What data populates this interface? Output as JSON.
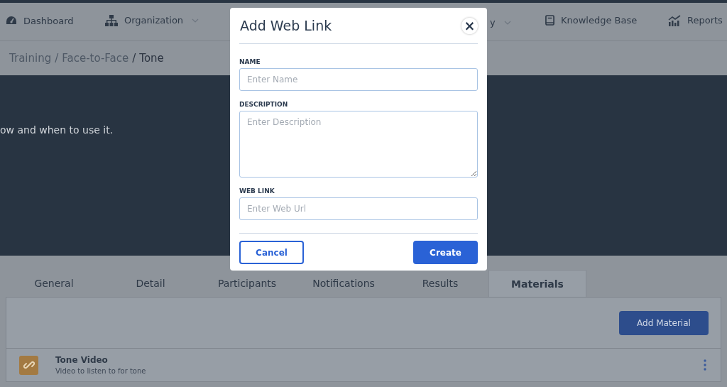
{
  "nav": [
    {
      "label": "Dashboard",
      "dropdown": false
    },
    {
      "label": "Organization",
      "dropdown": true
    },
    {
      "label": "y",
      "dropdown": true
    },
    {
      "label": "Knowledge Base",
      "dropdown": false
    },
    {
      "label": "Reports",
      "dropdown": false
    }
  ],
  "breadcrumb": [
    {
      "label": "Training",
      "current": false
    },
    {
      "separator": "/",
      "label": "Face-to-Face",
      "current": false
    },
    {
      "separator": "/",
      "label": "Tone",
      "current": true
    }
  ],
  "banner": {
    "text": "ow and when to use it."
  },
  "tabs": [
    {
      "label": "General",
      "selected": false
    },
    {
      "label": "Detail",
      "selected": false
    },
    {
      "label": "Participants",
      "selected": false
    },
    {
      "label": "Notifications",
      "selected": false
    },
    {
      "label": "Results",
      "selected": false
    },
    {
      "label": "Materials",
      "selected": true
    }
  ],
  "add_button": "Add Material",
  "materials": [
    {
      "title": "Tone Video",
      "description": "Video to listen to for tone"
    }
  ],
  "dialog": {
    "title": "Add Web Link",
    "close": "×",
    "fields": [
      {
        "label": "NAME",
        "placeholder": "Enter Name",
        "kind": "text"
      },
      {
        "label": "DESCRIPTION",
        "placeholder": "Enter Description",
        "kind": "textarea"
      },
      {
        "label": "WEB LINK",
        "placeholder": "Enter Web Url",
        "kind": "text"
      }
    ],
    "cancel": "Cancel",
    "create": "Create"
  }
}
